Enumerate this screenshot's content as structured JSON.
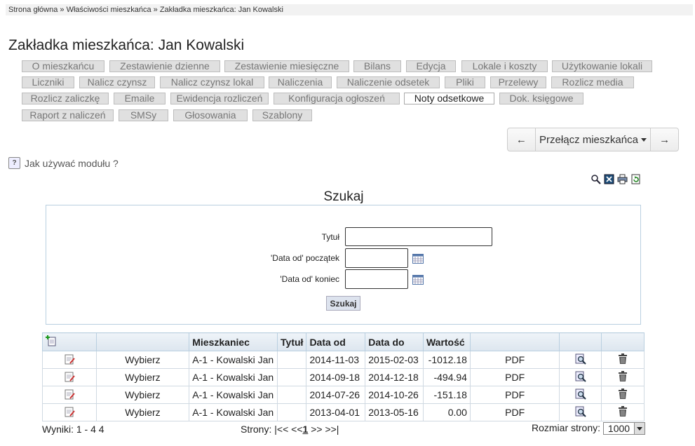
{
  "breadcrumb": {
    "home": "Strona główna",
    "sep": " » ",
    "props": "Właściwości mieszkańca",
    "current": "Zakładka mieszkańca: Jan Kowalski"
  },
  "page_title": "Zakładka mieszkańca: Jan Kowalski",
  "tabs_row1": [
    "O mieszkańcu",
    "Zestawienie dzienne",
    "Zestawienie miesięczne",
    "Bilans",
    "Edycja",
    "Lokale i koszty",
    "Użytkowanie lokali"
  ],
  "tabs_row2": [
    "Liczniki",
    "Nalicz czynsz",
    "Nalicz czynsz lokal",
    "Naliczenia",
    "Naliczenie odsetek",
    "Pliki",
    "Przelewy",
    "Rozlicz media"
  ],
  "tabs_row3": [
    "Rozlicz zaliczkę",
    "Emaile",
    "Ewidencja rozliczeń",
    "Konfiguracja ogłoszeń",
    "Noty odsetkowe",
    "Dok. księgowe"
  ],
  "tabs_row4": [
    "Raport z naliczeń",
    "SMSy",
    "Głosowania",
    "Szablony"
  ],
  "active_tab": "Noty odsetkowe",
  "switcher": {
    "prev": "←",
    "label": "Przełącz mieszkańca",
    "next": "→"
  },
  "help_text": "Jak używać modułu ?",
  "help_icon": "?",
  "search": {
    "title": "Szukaj",
    "title_label": "Tytuł",
    "date_from_start_label": "'Data od' początek",
    "date_from_end_label": "'Data od' koniec",
    "title_value": "",
    "date_from_start_value": "",
    "date_from_end_value": "",
    "button": "Szukaj"
  },
  "table": {
    "headers": {
      "mieszkaniec": "Mieszkaniec",
      "tytul": "Tytuł",
      "data_od": "Data od",
      "data_do": "Data do",
      "wartosc": "Wartość"
    },
    "rows": [
      {
        "select": "Wybierz",
        "mieszkaniec": "A-1 - Kowalski Jan",
        "tytul": "",
        "data_od": "2014-11-03",
        "data_do": "2015-02-03",
        "wartosc": "-1012.18",
        "pdf": "PDF"
      },
      {
        "select": "Wybierz",
        "mieszkaniec": "A-1 - Kowalski Jan",
        "tytul": "",
        "data_od": "2014-09-18",
        "data_do": "2014-12-18",
        "wartosc": "-494.94",
        "pdf": "PDF"
      },
      {
        "select": "Wybierz",
        "mieszkaniec": "A-1 - Kowalski Jan",
        "tytul": "",
        "data_od": "2014-07-26",
        "data_do": "2014-10-26",
        "wartosc": "-151.18",
        "pdf": "PDF"
      },
      {
        "select": "Wybierz",
        "mieszkaniec": "A-1 - Kowalski Jan",
        "tytul": "",
        "data_od": "2013-04-01",
        "data_do": "2013-05-16",
        "wartosc": "0.00",
        "pdf": "PDF"
      }
    ]
  },
  "footer": {
    "results": "Wyniki: 1 - 4 4",
    "pages_label": "Strony:",
    "pager_first": "|<<",
    "pager_prev": "<<",
    "current_page": "1",
    "pager_next": ">>",
    "pager_last": ">>|",
    "page_size_label": "Rozmiar strony:",
    "page_size": "1000"
  },
  "colors": {
    "tab_bg": "#e0e0e0",
    "tab_active_bg": "#ffffff",
    "border_blue": "#b9cfe0",
    "header_bg": "#dde6ef"
  },
  "icons": [
    "search-zoom-icon",
    "excel-export-icon",
    "print-icon",
    "refresh-icon",
    "add-record-icon",
    "edit-note-icon",
    "preview-icon",
    "trash-icon",
    "calendar-icon",
    "help-icon"
  ]
}
